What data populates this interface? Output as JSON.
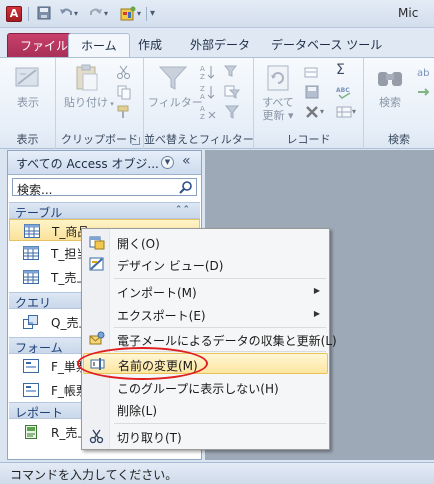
{
  "window": {
    "app_icon_letter": "A",
    "title_partial": "Mic"
  },
  "ribbon_tabs": [
    {
      "label": "ファイル"
    },
    {
      "label": "ホーム"
    },
    {
      "label": "作成"
    },
    {
      "label": "外部データ"
    },
    {
      "label": "データベース ツール"
    }
  ],
  "ribbon_groups": {
    "view": {
      "button": "表示",
      "label": "表示"
    },
    "clipboard": {
      "button": "貼り付け",
      "label": "クリップボード"
    },
    "sort_filter": {
      "button": "フィルター",
      "label": "並べ替えとフィルター"
    },
    "records": {
      "button_line1": "すべて",
      "button_line2": "更新 ▾",
      "label": "レコード",
      "sum_symbol": "Σ",
      "spell": "ABC"
    },
    "find": {
      "button": "検索",
      "label": "検索"
    }
  },
  "nav_pane": {
    "title": "すべての Access オブジ...",
    "search_placeholder": "検索...",
    "sections": [
      {
        "label": "テーブル",
        "items": [
          "T_商品",
          "T_担当",
          "T_売上"
        ]
      },
      {
        "label": "クエリ",
        "items": [
          "Q_売上"
        ]
      },
      {
        "label": "フォーム",
        "items": [
          "F_単票",
          "F_帳票"
        ]
      },
      {
        "label": "レポート",
        "items": [
          "R_売上"
        ]
      }
    ]
  },
  "context_menu": {
    "items": [
      {
        "label": "開く(O)",
        "icon": "open-icon"
      },
      {
        "label": "デザイン ビュー(D)",
        "icon": "design-view-icon"
      },
      {
        "label": "インポート(M)",
        "submenu": true
      },
      {
        "label": "エクスポート(E)",
        "submenu": true
      },
      {
        "label": "電子メールによるデータの収集と更新(L)",
        "icon": "email-collect-icon"
      },
      {
        "label": "名前の変更(M)",
        "icon": "rename-icon",
        "highlighted": true
      },
      {
        "label": "このグループに表示しない(H)"
      },
      {
        "label": "削除(L)"
      },
      {
        "label": "切り取り(T)",
        "icon": "scissors-icon"
      }
    ],
    "submenu_arrow": "▶"
  },
  "status_bar": {
    "text": "コマンドを入力してください。"
  },
  "colors": {
    "file_tab": "#b53461",
    "highlight": "#fde6a1",
    "annotation_oval": "#e02020",
    "section_text": "#1c3f75"
  }
}
